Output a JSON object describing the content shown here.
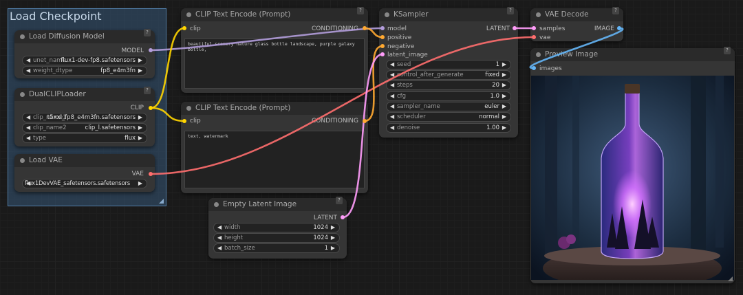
{
  "group": {
    "title": "Load Checkpoint"
  },
  "nodes": {
    "load_diffusion": {
      "title": "Load Diffusion Model",
      "output": "MODEL",
      "widgets": [
        {
          "name": "unet_name",
          "value": "flux1-dev-fp8.safetensors"
        },
        {
          "name": "weight_dtype",
          "value": "fp8_e4m3fn"
        }
      ]
    },
    "dual_clip": {
      "title": "DualCLIPLoader",
      "output": "CLIP",
      "widgets": [
        {
          "name": "clip_name1",
          "value": "t5xxl_fp8_e4m3fn.safetensors"
        },
        {
          "name": "clip_name2",
          "value": "clip_l.safetensors"
        },
        {
          "name": "type",
          "value": "flux"
        }
      ]
    },
    "load_vae": {
      "title": "Load VAE",
      "output": "VAE",
      "widgets": [
        {
          "name": "vae_name",
          "value": "flux1DevVAE_safetensors.safetensors"
        }
      ]
    },
    "clip_pos": {
      "title": "CLIP Text Encode (Prompt)",
      "input": "clip",
      "output": "CONDITIONING",
      "text": "beautiful scenery nature glass bottle landscape, purple galaxy bottle,"
    },
    "clip_neg": {
      "title": "CLIP Text Encode (Prompt)",
      "input": "clip",
      "output": "CONDITIONING",
      "text": "text, watermark"
    },
    "empty_latent": {
      "title": "Empty Latent Image",
      "output": "LATENT",
      "widgets": [
        {
          "name": "width",
          "value": "1024"
        },
        {
          "name": "height",
          "value": "1024"
        },
        {
          "name": "batch_size",
          "value": "1"
        }
      ]
    },
    "ksampler": {
      "title": "KSampler",
      "inputs": [
        "model",
        "positive",
        "negative",
        "latent_image"
      ],
      "output": "LATENT",
      "widgets": [
        {
          "name": "seed",
          "value": "1"
        },
        {
          "name": "control_after_generate",
          "value": "fixed"
        },
        {
          "name": "steps",
          "value": "20"
        },
        {
          "name": "cfg",
          "value": "1.0"
        },
        {
          "name": "sampler_name",
          "value": "euler"
        },
        {
          "name": "scheduler",
          "value": "normal"
        },
        {
          "name": "denoise",
          "value": "1.00"
        }
      ]
    },
    "vae_decode": {
      "title": "VAE Decode",
      "inputs": [
        "samples",
        "vae"
      ],
      "output": "IMAGE"
    },
    "preview": {
      "title": "Preview Image",
      "input": "images"
    }
  },
  "ui": {
    "help_glyph": "?",
    "arrow_left": "◀",
    "arrow_right": "▶"
  },
  "colors": {
    "model": "#b39ddb",
    "clip": "#ffd500",
    "vae": "#ff6e6e",
    "conditioning": "#ffa931",
    "latent": "#ff9cf9",
    "image": "#64b5f6"
  }
}
